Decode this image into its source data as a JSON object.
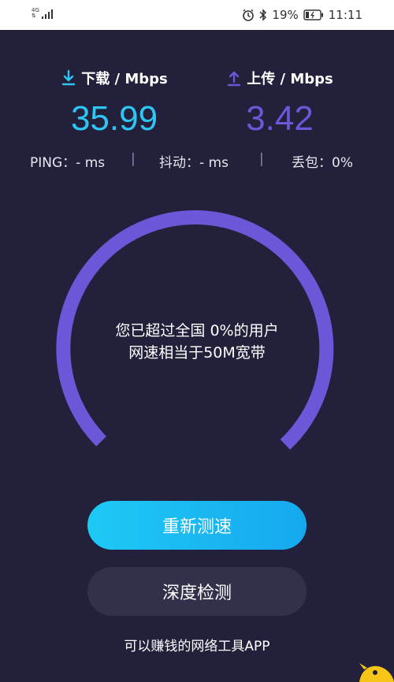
{
  "status_bar": {
    "network_type": "4G",
    "battery": "19%",
    "time": "11:11"
  },
  "download": {
    "label": "下载 / Mbps",
    "value": "35.99",
    "icon": "download-icon",
    "color": "#2ec5f4"
  },
  "upload": {
    "label": "上传 / Mbps",
    "value": "3.42",
    "icon": "upload-icon",
    "color": "#6c57d8"
  },
  "stats": {
    "ping": "PING：- ms",
    "jitter": "抖动：- ms",
    "packet_loss": "丢包：0%",
    "separator": "|"
  },
  "gauge": {
    "line1": "您已超过全国 0%的用户",
    "line2": "网速相当于50M宽带",
    "color": "#6c57d8"
  },
  "buttons": {
    "retest": "重新测速",
    "deep_check": "深度检测"
  },
  "footer": {
    "text": "可以赚钱的网络工具APP"
  }
}
